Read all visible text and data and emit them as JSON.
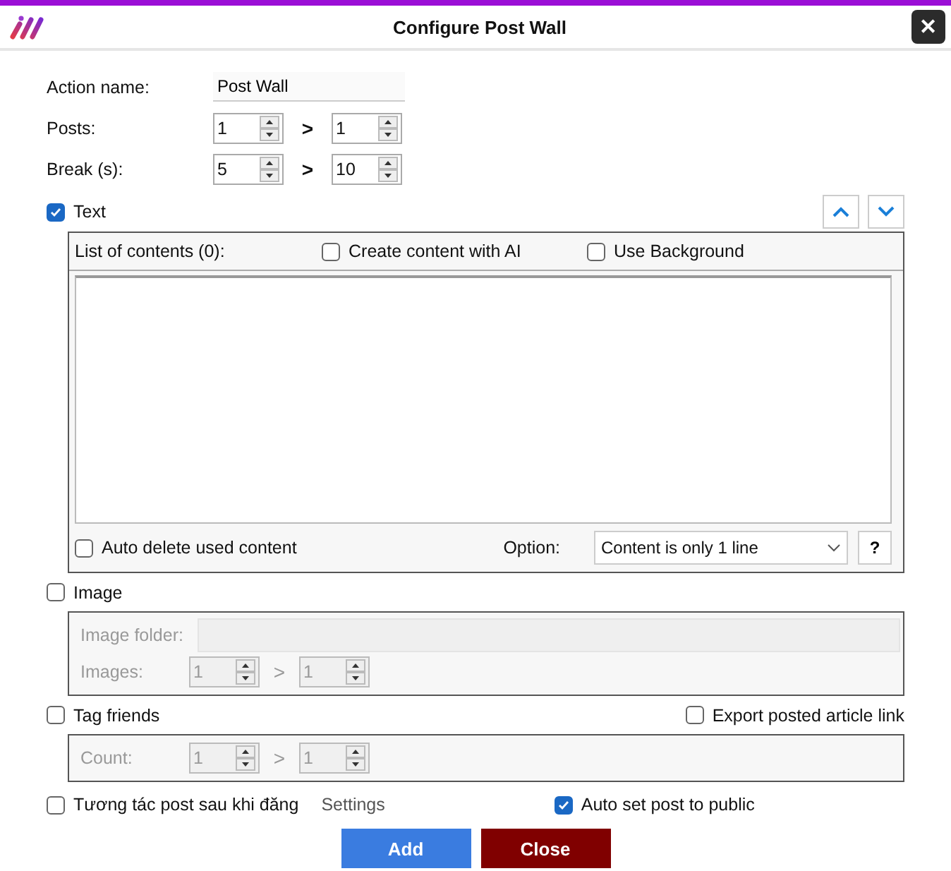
{
  "window": {
    "title": "Configure Post Wall",
    "close": "✕"
  },
  "action_name": {
    "label": "Action name:",
    "value": "Post Wall"
  },
  "ranges": [
    {
      "label": "Posts:",
      "from": "1",
      "to": "1",
      "separator": ">",
      "disabled": false
    },
    {
      "label": "Break (s):",
      "from": "5",
      "to": "10",
      "separator": ">",
      "disabled": false
    }
  ],
  "text_section": {
    "label": "Text",
    "checked": true,
    "list_label": "List of contents (0):",
    "options": [
      {
        "label": "Create content with AI",
        "checked": false
      },
      {
        "label": "Use Background",
        "checked": false
      }
    ],
    "auto_delete": {
      "label": "Auto delete used content",
      "checked": false
    },
    "option_label": "Option:",
    "option_value": "Content is only 1 line",
    "help": "?"
  },
  "image_section": {
    "label": "Image",
    "checked": false,
    "folder_label": "Image folder:",
    "range": {
      "label": "Images:",
      "from": "1",
      "to": "1",
      "separator": ">",
      "disabled": true
    }
  },
  "tag_section": {
    "label": "Tag friends",
    "checked": false,
    "export": {
      "label": "Export posted article link",
      "checked": false
    },
    "range": {
      "label": "Count:",
      "from": "1",
      "to": "1",
      "separator": ">",
      "disabled": true
    }
  },
  "interact": {
    "label": "Tương tác post sau khi đăng",
    "checked": false
  },
  "settings_link": "Settings",
  "auto_public": {
    "label": "Auto set post to public",
    "checked": true
  },
  "buttons": [
    {
      "label": "Add",
      "kind": "primary"
    },
    {
      "label": "Close",
      "kind": "danger"
    }
  ]
}
